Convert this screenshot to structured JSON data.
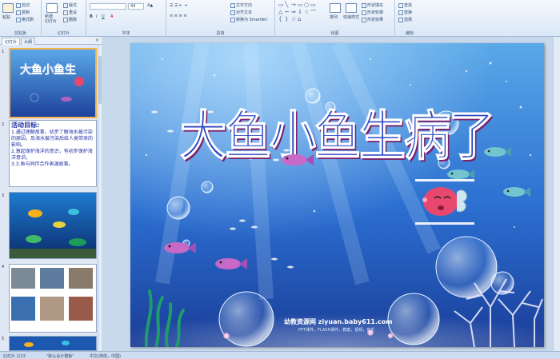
{
  "ribbon": {
    "groups": [
      {
        "name": "clipboard",
        "label": "剪贴板"
      },
      {
        "name": "slides",
        "label": "幻灯片"
      },
      {
        "name": "font",
        "label": "字体"
      },
      {
        "name": "paragraph",
        "label": "段落"
      },
      {
        "name": "drawing",
        "label": "绘图"
      },
      {
        "name": "editing",
        "label": "编辑"
      }
    ],
    "clipboard": {
      "paste": "粘贴",
      "cut": "剪切",
      "copy": "复制",
      "format_painter": "格式刷"
    },
    "slides": {
      "new_slide": "新建\n幻灯片",
      "layout": "版式",
      "reset": "重设",
      "delete": "删除"
    },
    "font": {
      "size": "44",
      "bold": "B",
      "italic": "I",
      "underline": "U"
    },
    "paragraph": {
      "text_direction": "文字方向",
      "align_text": "对齐文本",
      "smartart": "转换为 SmartArt"
    },
    "drawing": {
      "arrange": "排列",
      "quick_styles": "快速样式",
      "shape_fill": "形状填充",
      "shape_outline": "形状轮廓",
      "shape_effects": "形状效果"
    },
    "editing": {
      "find": "查找",
      "replace": "替换",
      "select": "选择"
    }
  },
  "panel": {
    "tabs": [
      "幻灯片",
      "大纲"
    ],
    "close": "×",
    "slide_numbers": [
      "1",
      "2",
      "3",
      "4",
      "5"
    ],
    "slide2": {
      "heading": "活动目标:",
      "lines": [
        "1.通过理解故事，初步了解海水被污染的原因，及海水被污染后给人类带来的影响。",
        "2.激起保护海洋的意识，有初步保护海洋意识。",
        "3.3.鱼与同伴合作表演故事。"
      ]
    }
  },
  "slide": {
    "title": "大鱼小鱼生病了",
    "watermark": "幼教资源网 ziyuan.baby611.com",
    "watermark_sub": "PPT课件，FLASH课件，教案，视频，音乐"
  },
  "status": {
    "slide_count": "幻灯片 1/13",
    "theme": "\"默认设计模板\"",
    "language": "中文(简体，中国)"
  },
  "colors": {
    "ribbon_bg": "#dbe7f6",
    "title_fill": "#2a45c2",
    "sea_top": "#5aa8e8",
    "sea_bottom": "#1a3d98",
    "selection": "#f2b44a"
  }
}
